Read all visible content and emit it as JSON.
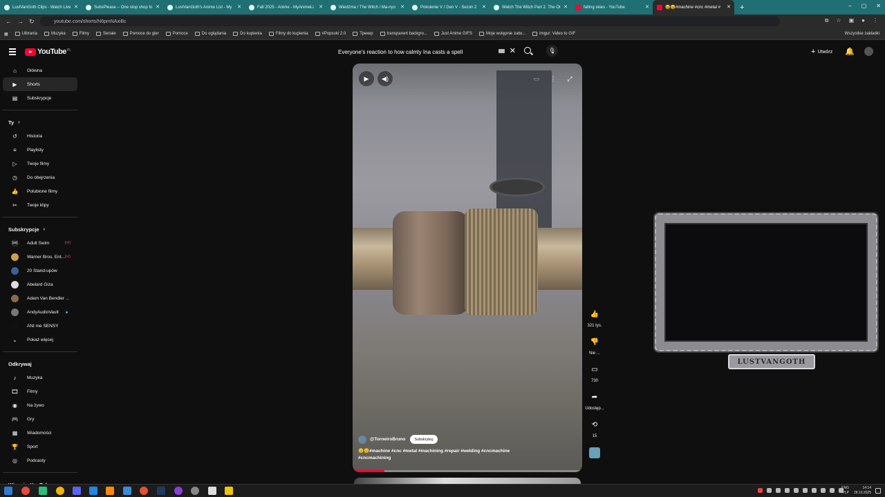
{
  "browser": {
    "tabs": [
      {
        "label": "LustVanGoth Clips - Watch Live"
      },
      {
        "label": "SubsPlease – One stop shop fo"
      },
      {
        "label": "LustVanGoth's Anime List - My"
      },
      {
        "label": "Fall 2025 - Anime - MyAnimeLi"
      },
      {
        "label": "Wiedźma / The Witch / Ma-nyo"
      },
      {
        "label": "Pokolenie V / Gen V - Sezon 2"
      },
      {
        "label": "Watch The Witch Part 2. The Ot"
      },
      {
        "label": "falling skies - YouTube"
      },
      {
        "label": "😀😀#machine #cnc #metal #"
      }
    ],
    "new_tab": "+",
    "window_controls": [
      "–",
      "▢",
      "✕"
    ],
    "url": "youtube.com/shorts/N6pmNAxiBc",
    "bookmarks": [
      "Ulbrania",
      "Muzyka",
      "Filmy",
      "Seriale",
      "Pomoce do gier",
      "Pomoce",
      "Do oglądania",
      "Do kupienia",
      "Filmy do kupienia",
      "#Popsuki 2.0",
      "Трекер",
      "transparent backgro...",
      "Just Anime GIFS",
      "Moje wstępnie zatw...",
      "Imgur: Video to GIF"
    ],
    "all_bookmarks": "Wszystkie zakładki"
  },
  "youtube": {
    "logo_text": "YouTube",
    "country": "PL",
    "search_value": "Everyone's reaction to how calmly Ina casts a spell",
    "create_label": "Utwórz",
    "sidebar": {
      "main": [
        {
          "label": "Główna",
          "icon": "home-icon",
          "glyph": "⌂"
        },
        {
          "label": "Shorts",
          "icon": "shorts-icon",
          "glyph": "▶"
        },
        {
          "label": "Subskrypcje",
          "icon": "subscriptions-icon",
          "glyph": "▤"
        }
      ],
      "you_header": "Ty",
      "you": [
        {
          "label": "Historia",
          "icon": "history-icon",
          "glyph": "↺"
        },
        {
          "label": "Playlisty",
          "icon": "playlists-icon",
          "glyph": "≡"
        },
        {
          "label": "Twoje filmy",
          "icon": "your-videos-icon",
          "glyph": "▷"
        },
        {
          "label": "Do obejrzenia",
          "icon": "watch-later-icon",
          "glyph": "◷"
        },
        {
          "label": "Polubione filmy",
          "icon": "liked-icon",
          "glyph": "👍"
        },
        {
          "label": "Twoje klipy",
          "icon": "clips-icon",
          "glyph": "✂"
        }
      ],
      "subs_header": "Subskrypcje",
      "subs": [
        {
          "label": "Adult Swim",
          "badge": "live"
        },
        {
          "label": "Warner Bros. Ent...",
          "badge": "live"
        },
        {
          "label": "20 Stand-upów",
          "badge": ""
        },
        {
          "label": "Abelard Giza",
          "badge": ""
        },
        {
          "label": "Adam Van Bendler ...",
          "badge": ""
        },
        {
          "label": "AndyAudioVault",
          "badge": "dot"
        },
        {
          "label": "ANI me SENSY",
          "badge": ""
        }
      ],
      "show_more": "Pokaż więcej",
      "explore_header": "Odkrywaj",
      "explore": [
        {
          "label": "Muzyka",
          "icon": "music-icon",
          "glyph": "♪"
        },
        {
          "label": "Filmy",
          "icon": "movies-icon",
          "glyph": "🎞"
        },
        {
          "label": "Na żywo",
          "icon": "live-icon",
          "glyph": "◉"
        },
        {
          "label": "Gry",
          "icon": "gaming-icon",
          "glyph": "🎮"
        },
        {
          "label": "Wiadomości",
          "icon": "news-icon",
          "glyph": "▦"
        },
        {
          "label": "Sport",
          "icon": "sport-icon",
          "glyph": "🏆"
        },
        {
          "label": "Podcasty",
          "icon": "podcasts-icon",
          "glyph": "◎"
        }
      ],
      "more_header": "Więcej z YouTube"
    },
    "short": {
      "channel": "@TorneiroBruno",
      "subscribe_label": "Subskrybuj",
      "title": "😊😊#machine #cnc #metal #machining #repair #welding #cncmachine #cncmachining",
      "progress": 0.14
    },
    "actions": {
      "likes": "321 tys.",
      "dislike": "Nie ...",
      "comments": "730",
      "share": "Udostęp...",
      "remix": "15"
    }
  },
  "overlay": {
    "plaque_text": "LUSTVANGOTH"
  },
  "taskbar": {
    "lang": "ENG",
    "lang_sub": "PLP",
    "time": "14:14",
    "date": "28.10.2025"
  }
}
